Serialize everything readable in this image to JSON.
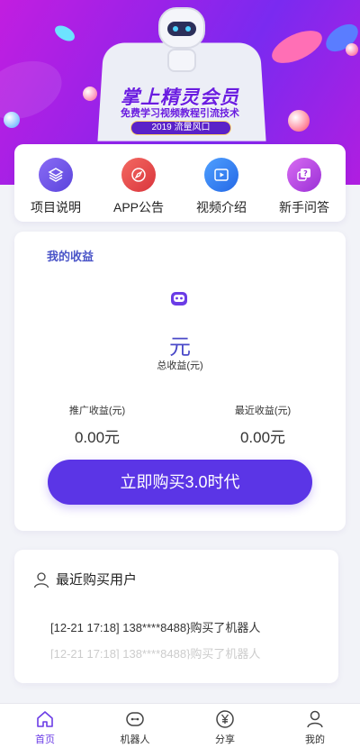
{
  "banner": {
    "title": "掌上精灵会员",
    "subtitle": "免费学习视频教程引流技术",
    "badge": "2019 流量风口"
  },
  "quick_menu": [
    {
      "label": "项目说明",
      "icon": "layers-icon",
      "color": "#6a54e8"
    },
    {
      "label": "APP公告",
      "icon": "compass-icon",
      "color": "#e8484f"
    },
    {
      "label": "视频介绍",
      "icon": "video-icon",
      "color": "#2f7cf0"
    },
    {
      "label": "新手问答",
      "icon": "question-chat-icon",
      "color": "#b03ee0"
    }
  ],
  "earnings": {
    "title": "我的收益",
    "icon": "robot-icon",
    "total_value": "元",
    "total_label": "总收益(元)",
    "promo_label": "推广收益(元)",
    "promo_value": "0.00元",
    "recent_label": "最近收益(元)",
    "recent_value": "0.00元",
    "buy_button": "立即购买3.0时代"
  },
  "recent_buyers": {
    "title": "最近购买用户",
    "rows": [
      "[12-21 17:18]  138****8488}购买了机器人",
      "[12-21 17:18]  138****8488}购买了机器人"
    ]
  },
  "tabbar": [
    {
      "label": "首页",
      "icon": "home-icon",
      "active": true
    },
    {
      "label": "机器人",
      "icon": "robot-icon",
      "active": false
    },
    {
      "label": "分享",
      "icon": "yen-icon",
      "active": false
    },
    {
      "label": "我的",
      "icon": "user-icon",
      "active": false
    }
  ],
  "colors": {
    "accent": "#5b35e6",
    "tab_active": "#6b3ce6",
    "earn_title": "#4b55c8"
  }
}
